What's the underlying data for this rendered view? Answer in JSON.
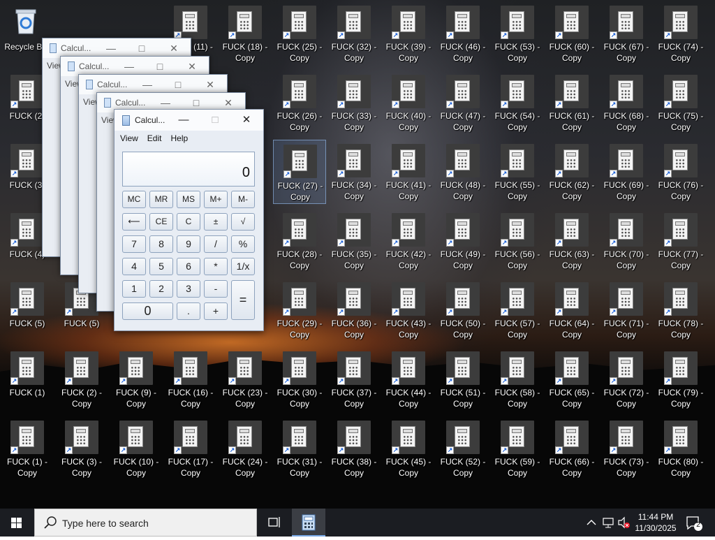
{
  "desktop": {
    "recycle_bin": "Recycle Bin",
    "icons": [
      {
        "label": "FUCK (2)"
      },
      {
        "label": "FUCK (3)"
      },
      {
        "label": "FUCK (4)"
      },
      {
        "label": "FUCK (5)"
      },
      {
        "label": "FUCK (1)"
      },
      {
        "label": "FUCK (1) -\nCopy"
      },
      {
        "label": "FUCK (5)"
      },
      {
        "label": "FUCK (2) -\nCopy"
      },
      {
        "label": "FUCK (3) -\nCopy"
      },
      {
        "label": "Copy"
      },
      {
        "label": "FUCK (9) -\nCopy"
      },
      {
        "label": "FUCK (10) -\nCopy"
      },
      {
        "label": "FUCK (11) -"
      },
      {
        "label": "Copy"
      },
      {
        "label": "FUCK (16) -\nCopy"
      },
      {
        "label": "FUCK (17) -\nCopy"
      },
      {
        "label": "FUCK (18) -\nCopy"
      },
      {
        "label": "Copy"
      },
      {
        "label": "FUCK (23) -\nCopy"
      },
      {
        "label": "FUCK (24) -\nCopy"
      },
      {
        "label": "FUCK (25) -\nCopy"
      },
      {
        "label": "FUCK (26) -\nCopy"
      },
      {
        "label": "FUCK (27) -\nCopy"
      },
      {
        "label": "FUCK (28) -\nCopy"
      },
      {
        "label": "FUCK (29) -\nCopy"
      },
      {
        "label": "FUCK (30) -\nCopy"
      },
      {
        "label": "FUCK (31) -\nCopy"
      },
      {
        "label": "FUCK (32) -\nCopy"
      },
      {
        "label": "FUCK (33) -\nCopy"
      },
      {
        "label": "FUCK (34) -\nCopy"
      },
      {
        "label": "FUCK (35) -\nCopy"
      },
      {
        "label": "FUCK (36) -\nCopy"
      },
      {
        "label": "FUCK (37) -\nCopy"
      },
      {
        "label": "FUCK (38) -\nCopy"
      },
      {
        "label": "FUCK (39) -\nCopy"
      },
      {
        "label": "FUCK (40) -\nCopy"
      },
      {
        "label": "FUCK (41) -\nCopy"
      },
      {
        "label": "FUCK (42) -\nCopy"
      },
      {
        "label": "FUCK (43) -\nCopy"
      },
      {
        "label": "FUCK (44) -\nCopy"
      },
      {
        "label": "FUCK (45) -\nCopy"
      },
      {
        "label": "FUCK (46) -\nCopy"
      },
      {
        "label": "FUCK (47) -\nCopy"
      },
      {
        "label": "FUCK (48) -\nCopy"
      },
      {
        "label": "FUCK (49) -\nCopy"
      },
      {
        "label": "FUCK (50) -\nCopy"
      },
      {
        "label": "FUCK (51) -\nCopy"
      },
      {
        "label": "FUCK (52) -\nCopy"
      },
      {
        "label": "FUCK (53) -\nCopy"
      },
      {
        "label": "FUCK (54) -\nCopy"
      },
      {
        "label": "FUCK (55) -\nCopy"
      },
      {
        "label": "FUCK (56) -\nCopy"
      },
      {
        "label": "FUCK (57) -\nCopy"
      },
      {
        "label": "FUCK (58) -\nCopy"
      },
      {
        "label": "FUCK (59) -\nCopy"
      },
      {
        "label": "FUCK (60) -\nCopy"
      },
      {
        "label": "FUCK (61) -\nCopy"
      },
      {
        "label": "FUCK (62) -\nCopy"
      },
      {
        "label": "FUCK (63) -\nCopy"
      },
      {
        "label": "FUCK (64) -\nCopy"
      },
      {
        "label": "FUCK (65) -\nCopy"
      },
      {
        "label": "FUCK (66) -\nCopy"
      },
      {
        "label": "FUCK (67) -\nCopy"
      },
      {
        "label": "FUCK (68) -\nCopy"
      },
      {
        "label": "FUCK (69) -\nCopy"
      },
      {
        "label": "FUCK (70) -\nCopy"
      },
      {
        "label": "FUCK (71) -\nCopy"
      },
      {
        "label": "FUCK (72) -\nCopy"
      },
      {
        "label": "FUCK (73) -\nCopy"
      },
      {
        "label": "FUCK (74) -\nCopy"
      },
      {
        "label": "FUCK (75) -\nCopy"
      },
      {
        "label": "FUCK (76) -\nCopy"
      },
      {
        "label": "FUCK (77) -\nCopy"
      },
      {
        "label": "FUCK (78) -\nCopy"
      },
      {
        "label": "FUCK (79) -\nCopy"
      },
      {
        "label": "FUCK (80) -\nCopy"
      }
    ]
  },
  "calculator": {
    "title": "Calcul...",
    "menu": [
      "View",
      "Edit",
      "Help"
    ],
    "display_value": "0",
    "keys": [
      "MC",
      "MR",
      "MS",
      "M+",
      "M-",
      "⟵",
      "CE",
      "C",
      "±",
      "√",
      "7",
      "8",
      "9",
      "/",
      "%",
      "4",
      "5",
      "6",
      "*",
      "1/x",
      "1",
      "2",
      "3",
      "-",
      "=",
      "0",
      ".",
      "+"
    ],
    "back_windows": [
      {
        "title": "Calcul...",
        "menu": "View"
      },
      {
        "title": "Calcul...",
        "menu": "View"
      },
      {
        "title": "Calcul...",
        "menu": "View"
      },
      {
        "title": "Calcul...",
        "menu": "View"
      }
    ]
  },
  "taskbar": {
    "search_placeholder": "Type here to search",
    "time": "11:44 PM",
    "date": "11/30/2025",
    "notification_count": "2"
  }
}
